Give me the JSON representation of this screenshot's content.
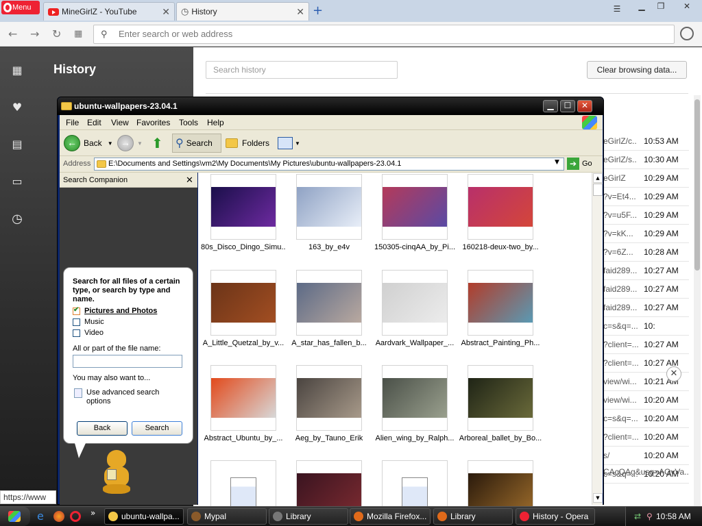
{
  "opera": {
    "menu_label": "Menu",
    "tabs": [
      {
        "title": "MineGirlZ - YouTube"
      },
      {
        "title": "History"
      }
    ],
    "new_tab": "+",
    "address_placeholder": "Enter search or web address"
  },
  "history_page": {
    "title": "History",
    "search_placeholder": "Search history",
    "clear_button": "Clear browsing data...",
    "rows": [
      {
        "url": "eGirlZ/c..",
        "time": "10:53 AM"
      },
      {
        "url": "eGirlZ/s..",
        "time": "10:30 AM"
      },
      {
        "url": "eGirlZ",
        "time": "10:29 AM"
      },
      {
        "url": "?v=Et4...",
        "time": "10:29 AM"
      },
      {
        "url": "?v=u5F...",
        "time": "10:29 AM"
      },
      {
        "url": "?v=kK...",
        "time": "10:29 AM"
      },
      {
        "url": "?v=6Z...",
        "time": "10:28 AM"
      },
      {
        "url": "faid289...",
        "time": "10:27 AM"
      },
      {
        "url": "faid289...",
        "time": "10:27 AM"
      },
      {
        "url": "faid289...",
        "time": "10:27 AM"
      },
      {
        "url": "c=s&q=...",
        "time": "10:"
      },
      {
        "url": "?client=...",
        "time": "10:27 AM"
      },
      {
        "url": "?client=...",
        "time": "10:27 AM"
      },
      {
        "url": "view/wi...",
        "time": "10:21 AM"
      },
      {
        "url": "view/wi...",
        "time": "10:20 AM"
      },
      {
        "url": "c=s&q=...",
        "time": "10:20 AM"
      },
      {
        "url": "?client=...",
        "time": "10:20 AM"
      },
      {
        "url": "s/",
        "time": "10:20 AM"
      },
      {
        "url": "c=s&q=...",
        "time": "10:20 AM"
      }
    ],
    "status_url": "https://www",
    "bottom_fragment": "CAcQAg&usg=AOvVa..."
  },
  "explorer": {
    "title": "ubuntu-wallpapers-23.04.1",
    "menu": [
      "File",
      "Edit",
      "View",
      "Favorites",
      "Tools",
      "Help"
    ],
    "toolbar": {
      "back": "Back",
      "search": "Search",
      "folders": "Folders"
    },
    "address_label": "Address",
    "address_path": "E:\\Documents and Settings\\vm2\\My Documents\\My Pictures\\ubuntu-wallpapers-23.04.1",
    "go_label": "Go",
    "search_companion": {
      "header": "Search Companion",
      "intro": "Search for all files of a certain type, or search by type and name.",
      "opt_pictures": "Pictures and Photos",
      "opt_music": "Music",
      "opt_video": "Video",
      "filename_label": "All or part of the file name:",
      "filename_value": "",
      "also_label": "You may also want to...",
      "advanced_option": "Use advanced search options",
      "back_button": "Back",
      "search_button": "Search"
    },
    "files": [
      {
        "name": "80s_Disco_Dingo_Simu...",
        "c1": "#1a0f4a",
        "c2": "#6d2aa0"
      },
      {
        "name": "163_by_e4v",
        "c1": "#8fa2c4",
        "c2": "#e8eef8"
      },
      {
        "name": "150305-cinqAA_by_Pi...",
        "c1": "#b43a5a",
        "c2": "#5a4aa4"
      },
      {
        "name": "160218-deux-two_by...",
        "c1": "#b8306a",
        "c2": "#d4463a"
      },
      {
        "name": "A_Little_Quetzal_by_v...",
        "c1": "#6b3418",
        "c2": "#a24e22"
      },
      {
        "name": "A_star_has_fallen_b...",
        "c1": "#5c6a86",
        "c2": "#b9a9a0"
      },
      {
        "name": "Aardvark_Wallpaper_...",
        "c1": "#d0d0d0",
        "c2": "#ececec"
      },
      {
        "name": "Abstract_Painting_Ph...",
        "c1": "#b23c2a",
        "c2": "#5a9ab4"
      },
      {
        "name": "Abstract_Ubuntu_by_...",
        "c1": "#e24a1c",
        "c2": "#d8d8d8"
      },
      {
        "name": "Aeg_by_Tauno_Erik",
        "c1": "#4a4440",
        "c2": "#a89a8a"
      },
      {
        "name": "Alien_wing_by_Ralph...",
        "c1": "#4a5048",
        "c2": "#9aa08e"
      },
      {
        "name": "Arboreal_ballet_by_Bo...",
        "c1": "#1f2416",
        "c2": "#6a6a3a"
      },
      {
        "name": "",
        "c1": "#ffffff",
        "c2": "#ffffff"
      },
      {
        "name": "",
        "c1": "#3a1420",
        "c2": "#7a2a30"
      },
      {
        "name": "",
        "c1": "#ffffff",
        "c2": "#ffffff"
      },
      {
        "name": "",
        "c1": "#2a1a0c",
        "c2": "#9a6a2a"
      }
    ]
  },
  "taskbar": {
    "tasks": [
      "ubuntu-wallpa...",
      "Mypal",
      "Library",
      "Mozilla Firefox...",
      "Library",
      "History - Opera"
    ],
    "clock": "10:58 AM"
  }
}
